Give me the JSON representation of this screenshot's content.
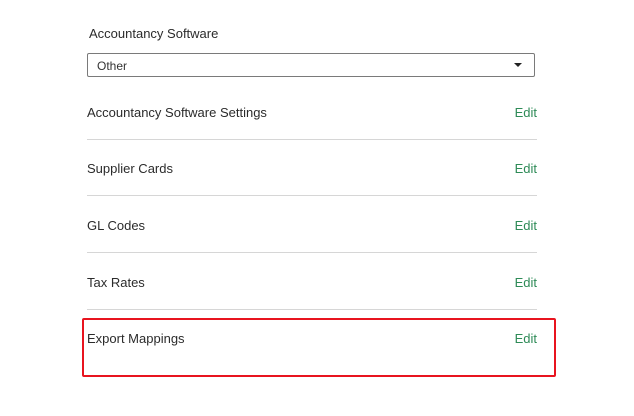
{
  "section": {
    "label": "Accountancy Software"
  },
  "software_select": {
    "value": "Other"
  },
  "rows": [
    {
      "label": "Accountancy Software Settings",
      "action": "Edit"
    },
    {
      "label": "Supplier Cards",
      "action": "Edit"
    },
    {
      "label": "GL Codes",
      "action": "Edit"
    },
    {
      "label": "Tax Rates",
      "action": "Edit"
    },
    {
      "label": "Export Mappings",
      "action": "Edit"
    }
  ],
  "colors": {
    "edit_link": "#2e8b57",
    "highlight": "#e8141f",
    "divider": "#d6d6d6"
  }
}
